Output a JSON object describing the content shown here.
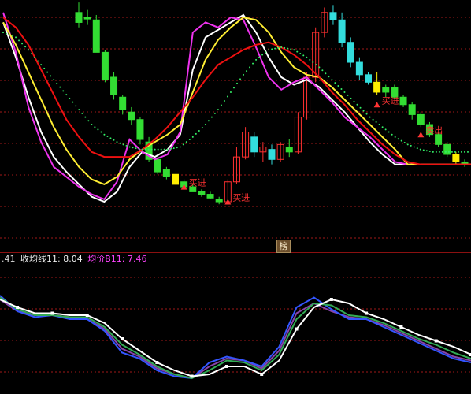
{
  "colors": {
    "background": "#000000",
    "grid": "#a01818",
    "divider": "#8b1010",
    "candle_up": "#ff3030",
    "candle_down": "#33dd33",
    "candle_cyan": "#33dddd",
    "candle_yellow": "#ffee00",
    "ma_white": "#ffffff",
    "ma_magenta": "#ee33ee",
    "ma_yellow": "#ffee33",
    "ma_red": "#ee1111",
    "ma_dots": "#33ee66",
    "signal": "#ff3333",
    "legend_value": "#dddddd",
    "legend_close": "#eeeeee",
    "legend_avg": "#ff44ff"
  },
  "panel_tag": {
    "label": "榜"
  },
  "legend": {
    "prefix": ".41",
    "close_ma_label": "收均线11: 8.04",
    "avg_label": "均价B11: 7.46"
  },
  "chart_data": [
    {
      "type": "line",
      "panel": "price",
      "x": [
        0,
        2,
        4,
        6,
        8,
        10,
        12,
        14,
        16,
        18,
        20,
        22,
        24,
        26,
        28,
        30,
        32,
        34,
        36,
        38,
        40,
        42,
        44,
        46,
        48,
        50,
        52,
        54,
        56,
        58,
        60,
        62,
        64,
        66,
        68,
        70,
        72,
        74
      ],
      "series": [
        {
          "color": "#ffffff",
          "values": [
            14.4,
            13.0,
            11.4,
            10.0,
            9.0,
            8.4,
            7.9,
            7.4,
            7.2,
            7.6,
            8.6,
            9.2,
            9.0,
            9.3,
            9.9,
            12.5,
            13.8,
            14.1,
            14.4,
            14.7,
            14.0,
            13.0,
            12.2,
            11.9,
            12.1,
            11.8,
            11.3,
            10.8,
            10.2,
            9.6,
            9.1,
            8.7,
            8.7,
            8.7,
            8.7,
            8.7,
            8.7,
            8.7
          ]
        },
        {
          "color": "#ee33ee",
          "values": [
            14.8,
            13.2,
            11.0,
            9.6,
            8.6,
            8.2,
            7.8,
            7.5,
            7.3,
            8.0,
            9.7,
            9.2,
            8.9,
            9.1,
            10.0,
            14.0,
            14.4,
            14.2,
            14.6,
            14.5,
            13.4,
            12.2,
            11.7,
            12.0,
            12.2,
            11.7,
            11.2,
            10.6,
            10.2,
            9.8,
            9.3,
            8.8,
            8.7,
            8.7,
            8.7,
            8.7,
            8.7,
            8.7
          ]
        },
        {
          "color": "#ffee33",
          "values": [
            14.4,
            13.5,
            12.4,
            11.3,
            10.2,
            9.3,
            8.6,
            8.1,
            7.9,
            8.2,
            8.9,
            9.3,
            9.6,
            9.9,
            10.3,
            11.6,
            12.9,
            13.7,
            14.2,
            14.6,
            14.5,
            14.0,
            13.2,
            12.6,
            12.3,
            12.2,
            11.8,
            11.3,
            10.8,
            10.3,
            9.8,
            9.3,
            8.7,
            8.7,
            8.7,
            8.7,
            8.7,
            8.7
          ]
        },
        {
          "color": "#ee1111",
          "values": [
            14.6,
            14.2,
            13.5,
            12.5,
            11.5,
            10.5,
            9.8,
            9.2,
            9.0,
            9.0,
            9.0,
            9.3,
            9.7,
            10.2,
            10.8,
            11.4,
            12.1,
            12.7,
            13.0,
            13.3,
            13.5,
            13.6,
            13.4,
            13.1,
            12.7,
            12.2,
            11.6,
            11.1,
            10.5,
            10.0,
            9.5,
            9.1,
            8.8,
            8.7,
            8.7,
            8.7,
            8.7,
            8.7
          ]
        }
      ],
      "dotted_series": {
        "color": "#33ee66",
        "values": [
          14.0,
          13.8,
          13.3,
          12.7,
          12.1,
          11.5,
          10.9,
          10.3,
          9.9,
          9.6,
          9.4,
          9.3,
          9.3,
          9.3,
          9.4,
          9.8,
          10.3,
          10.9,
          11.6,
          12.3,
          12.9,
          13.3,
          13.4,
          13.3,
          13.0,
          12.6,
          12.1,
          11.6,
          11.1,
          10.6,
          10.2,
          9.8,
          9.5,
          9.3,
          9.2,
          9.2,
          9.2,
          9.2
        ]
      },
      "candles": [
        {
          "x": 0,
          "o": 14.8,
          "h": 15.2,
          "l": 14.2,
          "c": 14.4,
          "color": "#33dd33"
        },
        {
          "x": 1,
          "o": 14.6,
          "h": 14.9,
          "l": 14.3,
          "c": 14.6,
          "color": "#33dd33"
        },
        {
          "x": 2,
          "o": 14.5,
          "h": 14.7,
          "l": 13.2,
          "c": 13.2,
          "color": "#33dd33"
        },
        {
          "x": 3,
          "o": 13.2,
          "h": 13.3,
          "l": 12.0,
          "c": 12.1,
          "color": "#33dd33"
        },
        {
          "x": 4,
          "o": 12.2,
          "h": 12.4,
          "l": 11.3,
          "c": 11.5,
          "color": "#33dd33"
        },
        {
          "x": 5,
          "o": 11.4,
          "h": 11.5,
          "l": 10.7,
          "c": 10.9,
          "color": "#33dd33"
        },
        {
          "x": 6,
          "o": 10.8,
          "h": 11.0,
          "l": 10.3,
          "c": 10.5,
          "color": "#33dd33"
        },
        {
          "x": 7,
          "o": 10.5,
          "h": 10.6,
          "l": 9.5,
          "c": 9.7,
          "color": "#33dd33"
        },
        {
          "x": 8,
          "o": 9.6,
          "h": 9.8,
          "l": 8.8,
          "c": 8.9,
          "color": "#33dd33"
        },
        {
          "x": 9,
          "o": 8.9,
          "h": 9.0,
          "l": 8.3,
          "c": 8.4,
          "color": "#33dd33"
        },
        {
          "x": 10,
          "o": 8.5,
          "h": 8.6,
          "l": 8.1,
          "c": 8.2,
          "color": "#33dd33"
        },
        {
          "x": 11,
          "o": 8.3,
          "h": 8.3,
          "l": 7.9,
          "c": 7.9,
          "color": "#ffee00"
        },
        {
          "x": 12,
          "o": 8.0,
          "h": 8.1,
          "l": 7.7,
          "c": 7.8,
          "color": "#33dd33"
        },
        {
          "x": 13,
          "o": 7.8,
          "h": 7.9,
          "l": 7.6,
          "c": 7.6,
          "color": "#33dd33"
        },
        {
          "x": 14,
          "o": 7.6,
          "h": 7.7,
          "l": 7.4,
          "c": 7.5,
          "color": "#33dd33"
        },
        {
          "x": 15,
          "o": 7.5,
          "h": 7.6,
          "l": 7.3,
          "c": 7.35,
          "color": "#33dd33"
        },
        {
          "x": 16,
          "o": 7.3,
          "h": 7.4,
          "l": 7.1,
          "c": 7.2,
          "color": "#33dd33"
        },
        {
          "x": 17,
          "o": 7.2,
          "h": 8.1,
          "l": 7.1,
          "c": 8.0,
          "color": "#ff3030"
        },
        {
          "x": 18,
          "o": 8.0,
          "h": 9.4,
          "l": 7.9,
          "c": 9.0,
          "color": "#ff3030"
        },
        {
          "x": 19,
          "o": 9.0,
          "h": 10.2,
          "l": 8.9,
          "c": 10.0,
          "color": "#ff3030"
        },
        {
          "x": 20,
          "o": 9.8,
          "h": 10.0,
          "l": 9.0,
          "c": 9.2,
          "color": "#33dddd"
        },
        {
          "x": 21,
          "o": 9.2,
          "h": 9.6,
          "l": 8.8,
          "c": 9.4,
          "color": "#ff3030"
        },
        {
          "x": 22,
          "o": 9.3,
          "h": 9.5,
          "l": 8.7,
          "c": 8.9,
          "color": "#33dddd"
        },
        {
          "x": 23,
          "o": 8.9,
          "h": 9.6,
          "l": 8.8,
          "c": 9.5,
          "color": "#ff3030"
        },
        {
          "x": 24,
          "o": 9.4,
          "h": 9.7,
          "l": 9.0,
          "c": 9.2,
          "color": "#33dd33"
        },
        {
          "x": 25,
          "o": 9.2,
          "h": 10.8,
          "l": 9.1,
          "c": 10.6,
          "color": "#ff3030"
        },
        {
          "x": 26,
          "o": 10.6,
          "h": 12.4,
          "l": 10.5,
          "c": 12.2,
          "color": "#ff3030"
        },
        {
          "x": 27,
          "o": 12.2,
          "h": 14.2,
          "l": 12.0,
          "c": 14.0,
          "color": "#ff3030"
        },
        {
          "x": 28,
          "o": 14.0,
          "h": 15.0,
          "l": 13.8,
          "c": 14.8,
          "color": "#ff3030"
        },
        {
          "x": 29,
          "o": 14.8,
          "h": 15.1,
          "l": 14.3,
          "c": 14.5,
          "color": "#33dddd"
        },
        {
          "x": 30,
          "o": 14.5,
          "h": 14.8,
          "l": 13.4,
          "c": 13.6,
          "color": "#33dddd"
        },
        {
          "x": 31,
          "o": 13.6,
          "h": 13.8,
          "l": 12.6,
          "c": 12.8,
          "color": "#33dddd"
        },
        {
          "x": 32,
          "o": 12.8,
          "h": 13.0,
          "l": 12.1,
          "c": 12.3,
          "color": "#33dddd"
        },
        {
          "x": 33,
          "o": 12.3,
          "h": 12.4,
          "l": 11.9,
          "c": 12.0,
          "color": "#33dddd"
        },
        {
          "x": 34,
          "o": 12.0,
          "h": 12.4,
          "l": 11.5,
          "c": 11.6,
          "color": "#ffee00"
        },
        {
          "x": 35,
          "o": 11.6,
          "h": 11.9,
          "l": 11.4,
          "c": 11.8,
          "color": "#33dd33"
        },
        {
          "x": 36,
          "o": 11.8,
          "h": 11.9,
          "l": 11.3,
          "c": 11.4,
          "color": "#33dd33"
        },
        {
          "x": 37,
          "o": 11.4,
          "h": 11.5,
          "l": 11.0,
          "c": 11.1,
          "color": "#33dd33"
        },
        {
          "x": 38,
          "o": 11.1,
          "h": 11.2,
          "l": 10.5,
          "c": 10.7,
          "color": "#33dd33"
        },
        {
          "x": 39,
          "o": 10.7,
          "h": 10.8,
          "l": 10.2,
          "c": 10.3,
          "color": "#33dd33"
        },
        {
          "x": 40,
          "o": 10.3,
          "h": 10.4,
          "l": 9.8,
          "c": 9.9,
          "color": "#33dd33"
        },
        {
          "x": 41,
          "o": 9.9,
          "h": 10.0,
          "l": 9.4,
          "c": 9.5,
          "color": "#33dd33"
        },
        {
          "x": 42,
          "o": 9.5,
          "h": 9.6,
          "l": 9.0,
          "c": 9.1,
          "color": "#33dd33"
        },
        {
          "x": 43,
          "o": 9.1,
          "h": 9.2,
          "l": 8.7,
          "c": 8.8,
          "color": "#ffee00"
        },
        {
          "x": 44,
          "o": 8.8,
          "h": 8.9,
          "l": 8.6,
          "c": 8.7,
          "color": "#33dd33"
        }
      ],
      "signals": [
        {
          "x": 17,
          "y": 7.5,
          "text": "买进"
        },
        {
          "x": 12,
          "y": 8.1,
          "text": "买进"
        },
        {
          "x": 34,
          "y": 11.4,
          "text": "买进"
        },
        {
          "x": 39,
          "y": 10.2,
          "text": "卖出"
        }
      ]
    },
    {
      "type": "line",
      "panel": "indicator",
      "series": [
        {
          "color": "#ffffff",
          "values": [
            8.0,
            7.6,
            7.3,
            7.3,
            7.2,
            7.2,
            6.8,
            6.0,
            5.4,
            4.8,
            4.4,
            4.1,
            4.2,
            4.6,
            4.6,
            4.2,
            4.9,
            6.5,
            7.6,
            8.0,
            7.8,
            7.3,
            7.0,
            6.6,
            6.2,
            5.9,
            5.6,
            5.2
          ]
        },
        {
          "color": "#33aa55",
          "values": [
            8.1,
            7.5,
            7.2,
            7.2,
            7.1,
            7.1,
            6.6,
            5.7,
            5.2,
            4.6,
            4.2,
            4.0,
            4.4,
            4.9,
            4.8,
            4.4,
            5.2,
            7.0,
            7.8,
            7.7,
            7.2,
            7.1,
            6.8,
            6.4,
            6.0,
            5.7,
            5.3,
            5.0
          ]
        },
        {
          "color": "#3355ff",
          "values": [
            8.2,
            7.4,
            7.1,
            7.2,
            7.0,
            7.0,
            6.4,
            5.3,
            5.0,
            4.4,
            4.1,
            4.0,
            4.8,
            5.1,
            4.9,
            4.6,
            5.6,
            7.6,
            8.1,
            7.5,
            7.0,
            7.0,
            6.6,
            6.2,
            5.8,
            5.4,
            5.0,
            4.8
          ]
        },
        {
          "color": "#8844aa",
          "values": [
            8.0,
            7.4,
            7.2,
            7.2,
            7.1,
            7.0,
            6.5,
            5.5,
            5.1,
            4.5,
            4.2,
            4.0,
            4.6,
            5.0,
            4.9,
            4.5,
            5.4,
            7.3,
            7.8,
            7.4,
            7.1,
            7.0,
            6.7,
            6.3,
            5.9,
            5.5,
            5.1,
            4.9
          ]
        }
      ]
    }
  ]
}
